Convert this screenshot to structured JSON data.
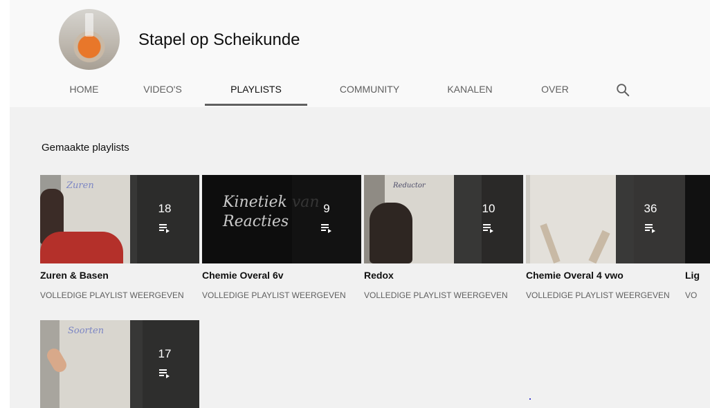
{
  "channel": {
    "name": "Stapel op Scheikunde",
    "avatar_icon": "erlenmeyer-flask-photo"
  },
  "tabs": [
    {
      "label": "HOME",
      "active": false
    },
    {
      "label": "VIDEO'S",
      "active": false
    },
    {
      "label": "PLAYLISTS",
      "active": true
    },
    {
      "label": "COMMUNITY",
      "active": false
    },
    {
      "label": "KANALEN",
      "active": false
    },
    {
      "label": "OVER",
      "active": false
    }
  ],
  "search_icon": "search-icon",
  "section_title": "Gemaakte playlists",
  "playlist_icon": "playlist-play-icon",
  "playlists": [
    {
      "title": "Zuren & Basen",
      "count": "18",
      "link": "VOLLEDIGE PLAYLIST WEERGEVEN",
      "thumb_text": "Zuren"
    },
    {
      "title": "Chemie Overal 6v",
      "count": "9",
      "link": "VOLLEDIGE PLAYLIST WEERGEVEN",
      "thumb_text": "Kinetiek van Reacties"
    },
    {
      "title": "Redox",
      "count": "10",
      "link": "VOLLEDIGE PLAYLIST WEERGEVEN",
      "thumb_text": "Reductor"
    },
    {
      "title": "Chemie Overal 4 vwo",
      "count": "36",
      "link": "VOLLEDIGE PLAYLIST WEERGEVEN",
      "thumb_text": ""
    },
    {
      "title": "Lig",
      "count": "",
      "link": "VO",
      "thumb_text": ""
    },
    {
      "title": "",
      "count": "17",
      "link": "",
      "thumb_text": "Soorten"
    }
  ]
}
